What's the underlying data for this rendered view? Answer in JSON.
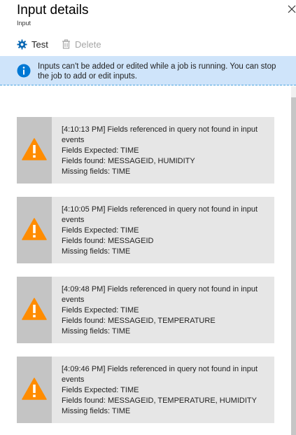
{
  "header": {
    "title": "Input details",
    "subtitle": "Input"
  },
  "toolbar": {
    "test_label": "Test",
    "delete_label": "Delete"
  },
  "info_bar": {
    "icon": "info-icon",
    "text": "Inputs can't be added or edited while a job is running. You can stop the job to add or edit inputs."
  },
  "events": [
    {
      "headline": "[4:10:13 PM] Fields referenced in query not found in input events",
      "expected": "Fields Expected: TIME",
      "found": "Fields found: MESSAGEID, HUMIDITY",
      "missing": "Missing fields: TIME"
    },
    {
      "headline": "[4:10:05 PM] Fields referenced in query not found in input events",
      "expected": "Fields Expected: TIME",
      "found": "Fields found: MESSAGEID",
      "missing": "Missing fields: TIME"
    },
    {
      "headline": "[4:09:48 PM] Fields referenced in query not found in input events",
      "expected": "Fields Expected: TIME",
      "found": "Fields found: MESSAGEID, TEMPERATURE",
      "missing": "Missing fields: TIME"
    },
    {
      "headline": "[4:09:46 PM] Fields referenced in query not found in input events",
      "expected": "Fields Expected: TIME",
      "found": "Fields found: MESSAGEID, TEMPERATURE, HUMIDITY",
      "missing": "Missing fields: TIME"
    }
  ],
  "colors": {
    "warning": "#ff8c00",
    "info_blue": "#0078d4",
    "info_bg": "#cfe4fa"
  }
}
